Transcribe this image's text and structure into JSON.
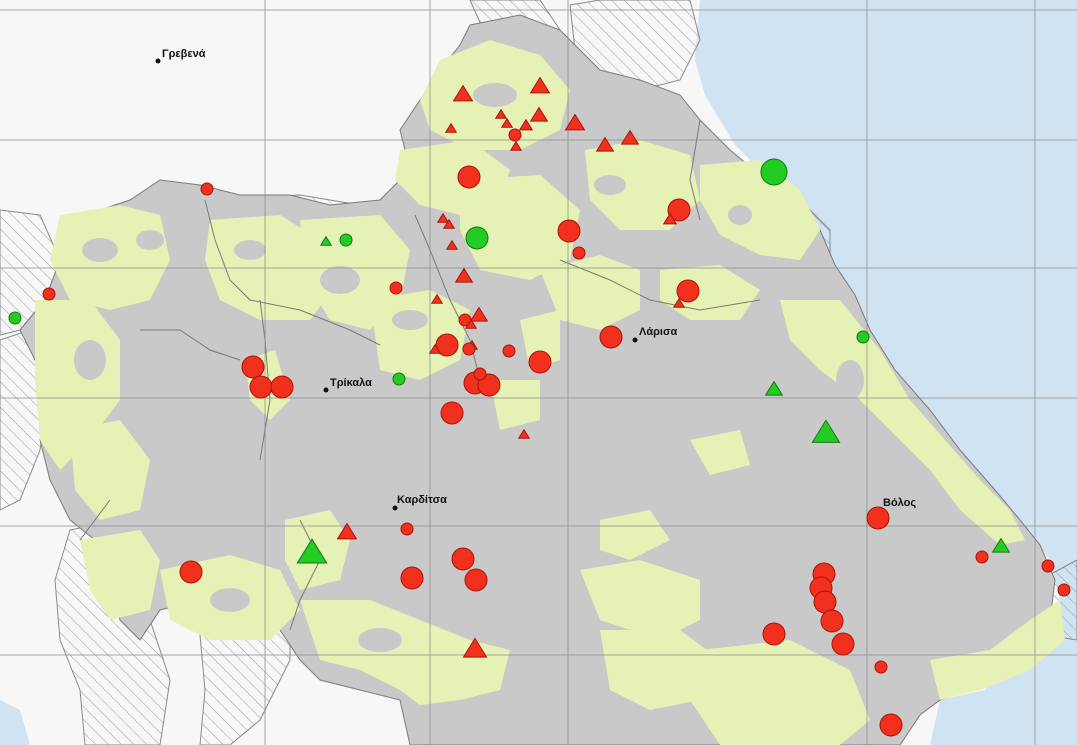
{
  "map": {
    "colors": {
      "sea": "#cfe3f2",
      "sea_deep": "#b9d6ee",
      "land_outside": "#f7f7f7",
      "region": "#c9c9c9",
      "vegetation": "#e6f2b5",
      "border": "#7a7a7a",
      "grid": "#8c8c8c",
      "red_marker": "#f2301e",
      "red_marker_stroke": "#a8140a",
      "green_marker": "#22cc22",
      "green_marker_stroke": "#147814"
    },
    "cities": [
      {
        "name": "Γρεβενά"
      },
      {
        "name": "Τρίκαλα"
      },
      {
        "name": "Λάρισα"
      },
      {
        "name": "Καρδίτσα"
      },
      {
        "name": "Βόλος"
      }
    ],
    "marker_types": [
      "red-circle",
      "red-triangle",
      "green-circle",
      "green-triangle"
    ]
  }
}
